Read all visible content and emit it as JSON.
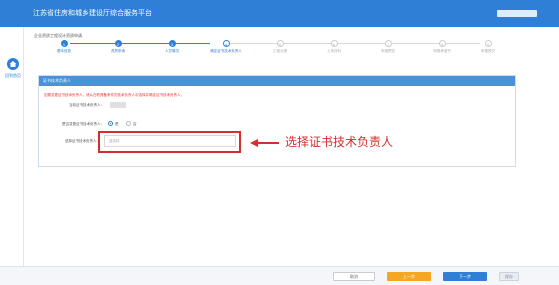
{
  "header": {
    "title": "江苏省住房和城乡建设厅综合服务平台"
  },
  "sidebar": {
    "home_label": "回到首页"
  },
  "page": {
    "title": "企业资质工程设计资质申请"
  },
  "steps": [
    {
      "num": "1",
      "label": "基本信息",
      "state": "done"
    },
    {
      "num": "2",
      "label": "资质申请",
      "state": "done"
    },
    {
      "num": "3",
      "label": "人员情况",
      "state": "done"
    },
    {
      "num": "4",
      "label": "确定证书技术负责人",
      "state": "current"
    },
    {
      "num": "5",
      "label": "工程业绩",
      "state": "todo"
    },
    {
      "num": "6",
      "label": "上传材料",
      "state": "todo"
    },
    {
      "num": "7",
      "label": "申报预览",
      "state": "todo"
    },
    {
      "num": "8",
      "label": "申报承诺书",
      "state": "todo"
    },
    {
      "num": "9",
      "label": "申报提交",
      "state": "todo"
    }
  ],
  "section": {
    "title": "证书技术负责人",
    "warning": "如需变更证书技术负责人，请从在职具备条件的技术负责人中选择并确定证书技术负责人。",
    "current_label": "当前证书技术负责人：",
    "change_label": "是否变更证书技术负责人：",
    "option_yes": "是",
    "option_no": "否",
    "select_label": "选择证书技术负责人：",
    "select_placeholder": "请选择"
  },
  "annotation": {
    "text": "选择证书技术负责人"
  },
  "footer": {
    "cancel": "取消",
    "prev": "上一步",
    "next": "下一步",
    "save": "保存"
  },
  "colors": {
    "primary": "#2f7fd6",
    "warning_red": "#d32f2f",
    "prev_orange": "#f5a623"
  }
}
